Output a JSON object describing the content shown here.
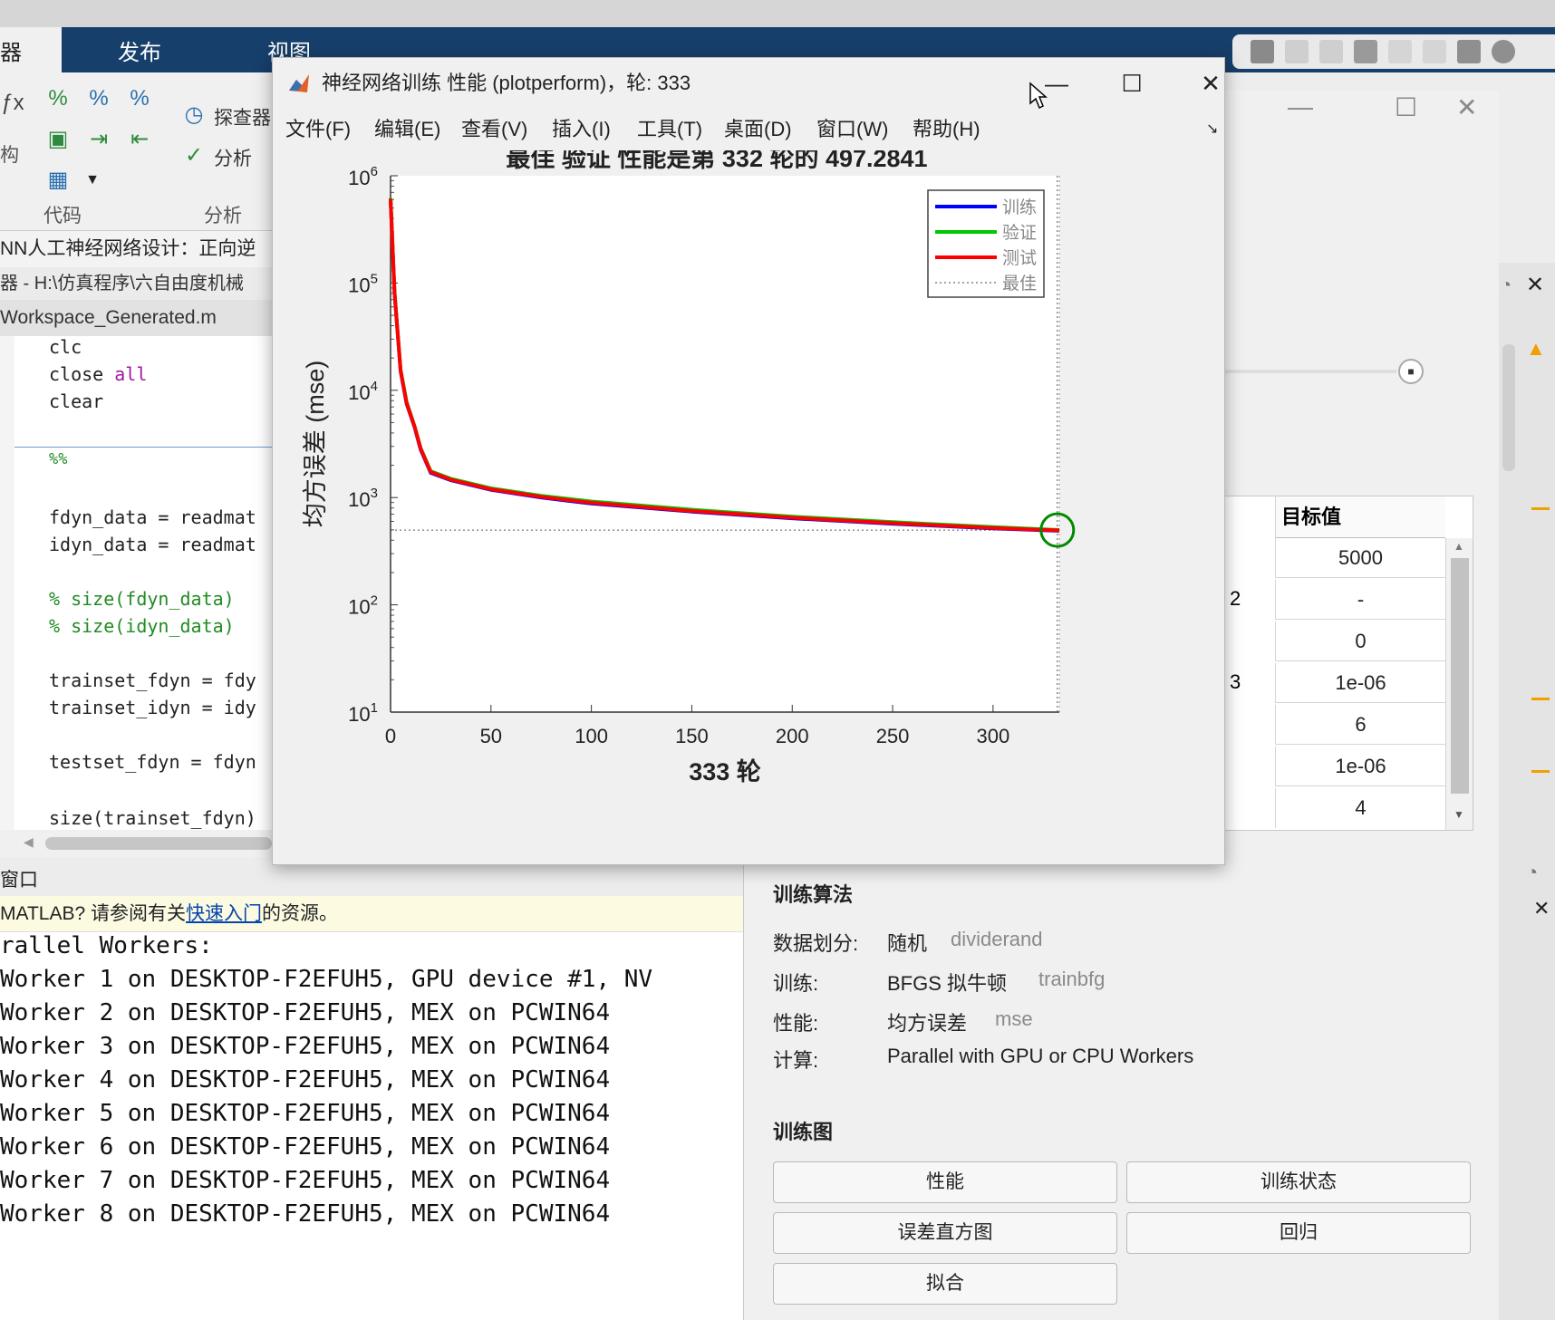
{
  "ribbon": {
    "tabs": [
      "器",
      "发布",
      "视图"
    ],
    "groups": [
      "代码",
      "分析"
    ],
    "buttons": {
      "explorer": "探查器",
      "analyze": "分析"
    },
    "left_cut_label": "构"
  },
  "editor": {
    "title": "NN人工神经网络设计：正向逆",
    "path": "器 - H:\\仿真程序\\六自由度机械",
    "tab": "Workspace_Generated.m",
    "code": [
      {
        "kind": "plain",
        "text": "clc"
      },
      {
        "kind": "kw",
        "pre": "close ",
        "kw": "all"
      },
      {
        "kind": "plain",
        "text": "clear"
      },
      {
        "kind": "cm",
        "text": "%%"
      },
      {
        "kind": "plain",
        "text": "fdyn_data = readmat"
      },
      {
        "kind": "plain",
        "text": "idyn_data = readmat"
      },
      {
        "kind": "cm",
        "text": "% size(fdyn_data)"
      },
      {
        "kind": "cm",
        "text": "% size(idyn_data)"
      },
      {
        "kind": "plain",
        "text": "trainset_fdyn = fdy"
      },
      {
        "kind": "plain",
        "text": "trainset_idyn = idy"
      },
      {
        "kind": "plain",
        "text": "testset_fdyn = fdyn"
      },
      {
        "kind": "plain",
        "text": "size(trainset_fdyn)"
      }
    ]
  },
  "command_window": {
    "header": "窗口",
    "notice_prefix": "MATLAB? 请参阅有关",
    "notice_link": "快速入门",
    "notice_suffix": "的资源。",
    "lines": [
      "rallel Workers:",
      "Worker 1 on DESKTOP-F2EFUH5, GPU device #1, NV",
      "Worker 2 on DESKTOP-F2EFUH5, MEX on PCWIN64",
      "Worker 3 on DESKTOP-F2EFUH5, MEX on PCWIN64",
      "Worker 4 on DESKTOP-F2EFUH5, MEX on PCWIN64",
      "Worker 5 on DESKTOP-F2EFUH5, MEX on PCWIN64",
      "Worker 6 on DESKTOP-F2EFUH5, MEX on PCWIN64",
      "Worker 7 on DESKTOP-F2EFUH5, MEX on PCWIN64",
      "Worker 8 on DESKTOP-F2EFUH5, MEX on PCWIN64"
    ]
  },
  "nntrain": {
    "table_header": "目标值",
    "table_values": [
      "5000",
      "-",
      "0",
      "1e-06",
      "6",
      "1e-06",
      "4"
    ],
    "left_fragments": [
      "2",
      "3"
    ],
    "algorithm_title": "训练算法",
    "algorithm": [
      {
        "key": "数据划分:",
        "value": "随机",
        "sub": "dividerand"
      },
      {
        "key": "训练:",
        "value": "BFGS 拟牛顿",
        "sub": "trainbfg"
      },
      {
        "key": "性能:",
        "value": "均方误差",
        "sub": "mse"
      },
      {
        "key": "计算:",
        "value": "Parallel with GPU or CPU Workers",
        "sub": ""
      }
    ],
    "plots_title": "训练图",
    "plot_buttons": [
      "性能",
      "训练状态",
      "误差直方图",
      "回归",
      "拟合"
    ]
  },
  "figure": {
    "title": "神经网络训练 性能 (plotperform)，轮: 333",
    "menus": [
      "文件(F)",
      "编辑(E)",
      "查看(V)",
      "插入(I)",
      "工具(T)",
      "桌面(D)",
      "窗口(W)",
      "帮助(H)"
    ],
    "window_buttons": {
      "minimize": "—",
      "maximize": "☐",
      "close": "✕"
    }
  },
  "chart_data": {
    "type": "line",
    "title": "最佳 验证 性能是第 332 轮的 497.2841",
    "xlabel": "333 轮",
    "ylabel": "均方误差 (mse)",
    "xlim": [
      0,
      333
    ],
    "ylim": [
      10,
      1000000
    ],
    "yscale": "log",
    "x_ticks": [
      "0",
      "50",
      "100",
      "150",
      "200",
      "250",
      "300"
    ],
    "y_ticks": [
      {
        "base": "10",
        "exp": "1"
      },
      {
        "base": "10",
        "exp": "2"
      },
      {
        "base": "10",
        "exp": "3"
      },
      {
        "base": "10",
        "exp": "4"
      },
      {
        "base": "10",
        "exp": "5"
      },
      {
        "base": "10",
        "exp": "6"
      }
    ],
    "legend_position": "top-right",
    "series": [
      {
        "name": "训练",
        "color": "#0000ff",
        "x": [
          0,
          2,
          5,
          8,
          12,
          15,
          20,
          30,
          50,
          75,
          100,
          150,
          200,
          250,
          300,
          333
        ],
        "y": [
          600000,
          80000,
          15000,
          7500,
          4500,
          2800,
          1700,
          1450,
          1180,
          1000,
          880,
          740,
          640,
          570,
          515,
          490
        ]
      },
      {
        "name": "验证",
        "color": "#00c800",
        "x": [
          0,
          2,
          5,
          8,
          12,
          15,
          20,
          30,
          50,
          75,
          100,
          150,
          200,
          250,
          300,
          333
        ],
        "y": [
          620000,
          82000,
          15500,
          7800,
          4600,
          2900,
          1760,
          1500,
          1220,
          1040,
          920,
          770,
          665,
          590,
          530,
          498
        ]
      },
      {
        "name": "测试",
        "color": "#ff0000",
        "x": [
          0,
          2,
          5,
          8,
          12,
          15,
          20,
          30,
          50,
          75,
          100,
          150,
          200,
          250,
          300,
          333
        ],
        "y": [
          610000,
          81000,
          15200,
          7600,
          4550,
          2850,
          1730,
          1470,
          1195,
          1015,
          895,
          750,
          650,
          578,
          520,
          494
        ]
      },
      {
        "name": "最佳",
        "color": "#444444",
        "dotted": true,
        "best_x": 332,
        "best_y": 497.2841
      }
    ]
  }
}
